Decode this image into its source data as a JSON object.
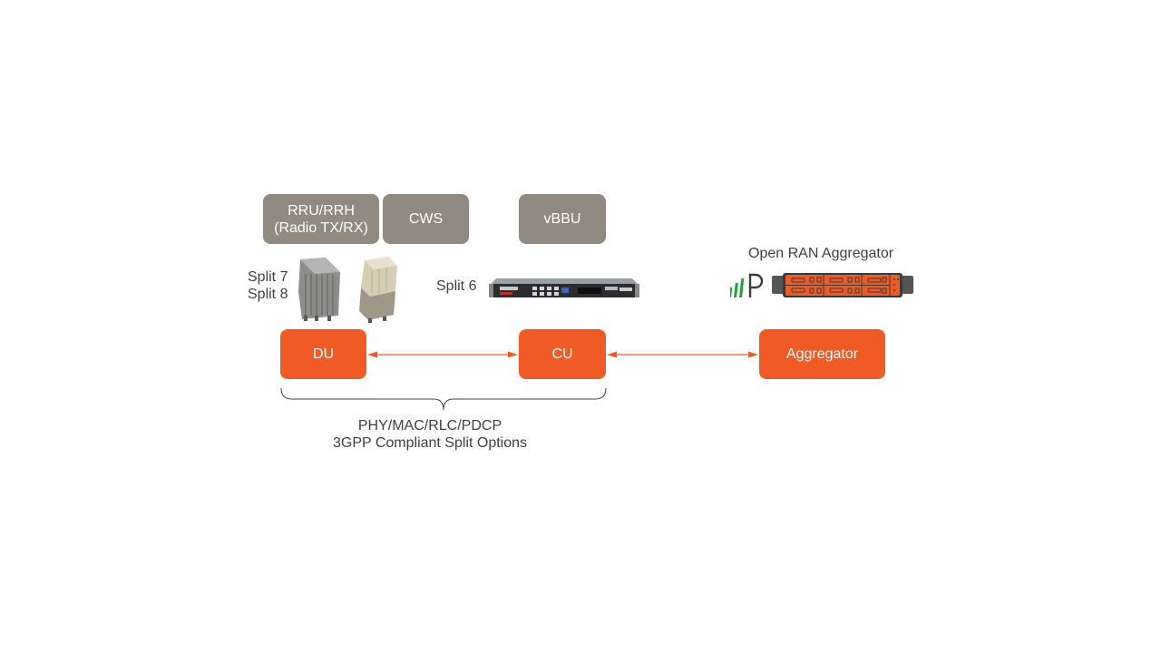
{
  "colors": {
    "category_box": "#918a80",
    "component_box": "#f05a25",
    "connector": "#f05a25",
    "brace": "#404040",
    "text": "#404040",
    "logo_green": "#21a038"
  },
  "categories": [
    {
      "id": "rru",
      "line1": "RRU/RRH",
      "line2": "(Radio TX/RX)"
    },
    {
      "id": "cws",
      "line1": "CWS"
    },
    {
      "id": "vbbu",
      "line1": "vBBU"
    }
  ],
  "split_labels": {
    "du_line1": "Split 7",
    "du_line2": "Split 8",
    "cu": "Split 6"
  },
  "aggregator_title": "Open RAN Aggregator",
  "components": [
    {
      "id": "du",
      "label": "DU"
    },
    {
      "id": "cu",
      "label": "CU"
    },
    {
      "id": "aggregator",
      "label": "Aggregator"
    }
  ],
  "connections": [
    {
      "from": "DU",
      "to": "CU",
      "bidirectional": true
    },
    {
      "from": "CU",
      "to": "Aggregator",
      "bidirectional": true
    }
  ],
  "brace_caption": {
    "line1": "PHY/MAC/RLC/PDCP",
    "line2": "3GPP Compliant Split Options"
  },
  "images": {
    "radio_unit_1": "radio-unit-grey-icon",
    "radio_unit_2": "radio-unit-beige-icon",
    "server": "rack-server-icon",
    "logo": "parallel-wireless-logo-icon",
    "aggregator_hw": "orange-rack-server-icon"
  }
}
